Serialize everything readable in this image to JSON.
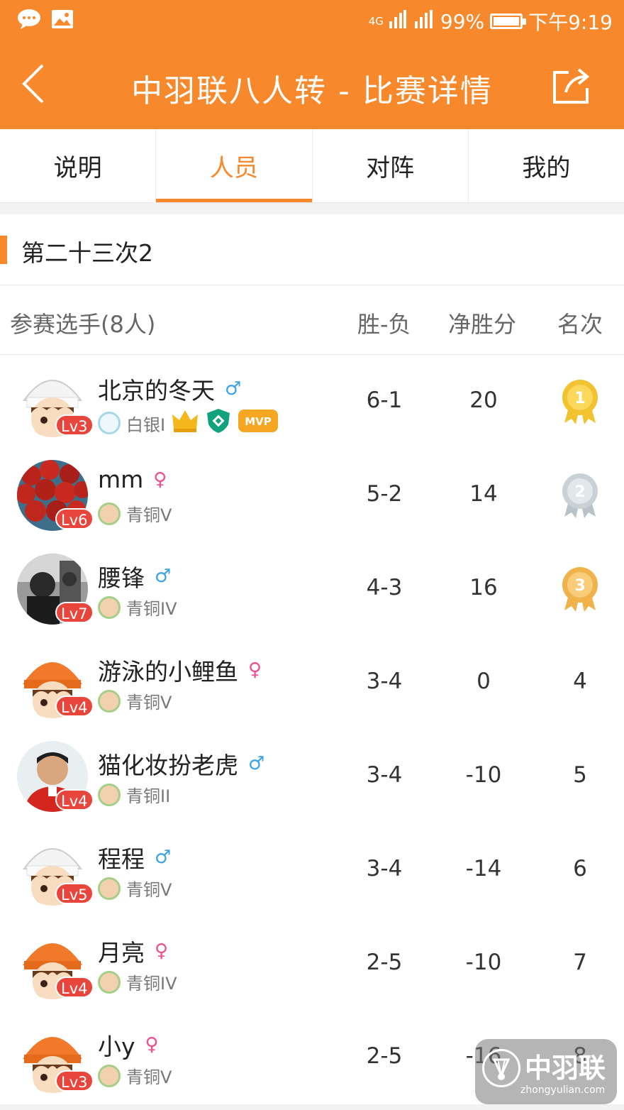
{
  "status_bar": {
    "network": "4G",
    "battery": "99%",
    "battery_level": 0.99,
    "time": "下午9:19",
    "icons": [
      "chat-bubble-icon",
      "image-icon",
      "signal-icon",
      "battery-icon"
    ]
  },
  "app_bar": {
    "title": "中羽联八人转 - 比赛详情",
    "back_icon": "chevron-left-icon",
    "share_icon": "share-icon"
  },
  "tabs": [
    {
      "label": "说明",
      "active": false
    },
    {
      "label": "人员",
      "active": true
    },
    {
      "label": "对阵",
      "active": false
    },
    {
      "label": "我的",
      "active": false
    }
  ],
  "section": {
    "title": "第二十三次2"
  },
  "table": {
    "headers": {
      "players": "参赛选手(8人)",
      "win_loss": "胜-负",
      "net_points": "净胜分",
      "rank": "名次"
    },
    "rows": [
      {
        "name": "北京的冬天",
        "gender": "male",
        "gender_symbol": "♂",
        "level": "Lv3",
        "rank_title": "白银I",
        "badges": [
          "crown-icon",
          "shield-badge-icon",
          "mvp-badge"
        ],
        "mvp_label": "MVP",
        "win_loss": "6-1",
        "net": "20",
        "rank": "1"
      },
      {
        "name": "mm",
        "gender": "female",
        "gender_symbol": "♀",
        "level": "Lv6",
        "rank_title": "青铜V",
        "win_loss": "5-2",
        "net": "14",
        "rank": "2"
      },
      {
        "name": "腰锋",
        "gender": "male",
        "gender_symbol": "♂",
        "level": "Lv7",
        "rank_title": "青铜IV",
        "win_loss": "4-3",
        "net": "16",
        "rank": "3"
      },
      {
        "name": "游泳的小鲤鱼",
        "gender": "female",
        "gender_symbol": "♀",
        "level": "Lv4",
        "rank_title": "青铜V",
        "win_loss": "3-4",
        "net": "0",
        "rank": "4"
      },
      {
        "name": "猫化妆扮老虎",
        "gender": "male",
        "gender_symbol": "♂",
        "level": "Lv4",
        "rank_title": "青铜II",
        "win_loss": "3-4",
        "net": "-10",
        "rank": "5"
      },
      {
        "name": "程程",
        "gender": "male",
        "gender_symbol": "♂",
        "level": "Lv5",
        "rank_title": "青铜V",
        "win_loss": "3-4",
        "net": "-14",
        "rank": "6"
      },
      {
        "name": "月亮",
        "gender": "female",
        "gender_symbol": "♀",
        "level": "Lv4",
        "rank_title": "青铜IV",
        "win_loss": "2-5",
        "net": "-10",
        "rank": "7"
      },
      {
        "name": "小y",
        "gender": "female",
        "gender_symbol": "♀",
        "level": "Lv3",
        "rank_title": "青铜V",
        "win_loss": "2-5",
        "net": "-16",
        "rank": "8"
      }
    ]
  },
  "watermark": {
    "name": "中羽联",
    "url": "zhongyulian.com"
  },
  "colors": {
    "accent": "#f7882b",
    "level_badge": "#e8453c",
    "male": "#3aa3e8",
    "female": "#ef4e8f",
    "gold": "#f2c230",
    "silver": "#c9d1d6",
    "bronze": "#f0b24a"
  }
}
